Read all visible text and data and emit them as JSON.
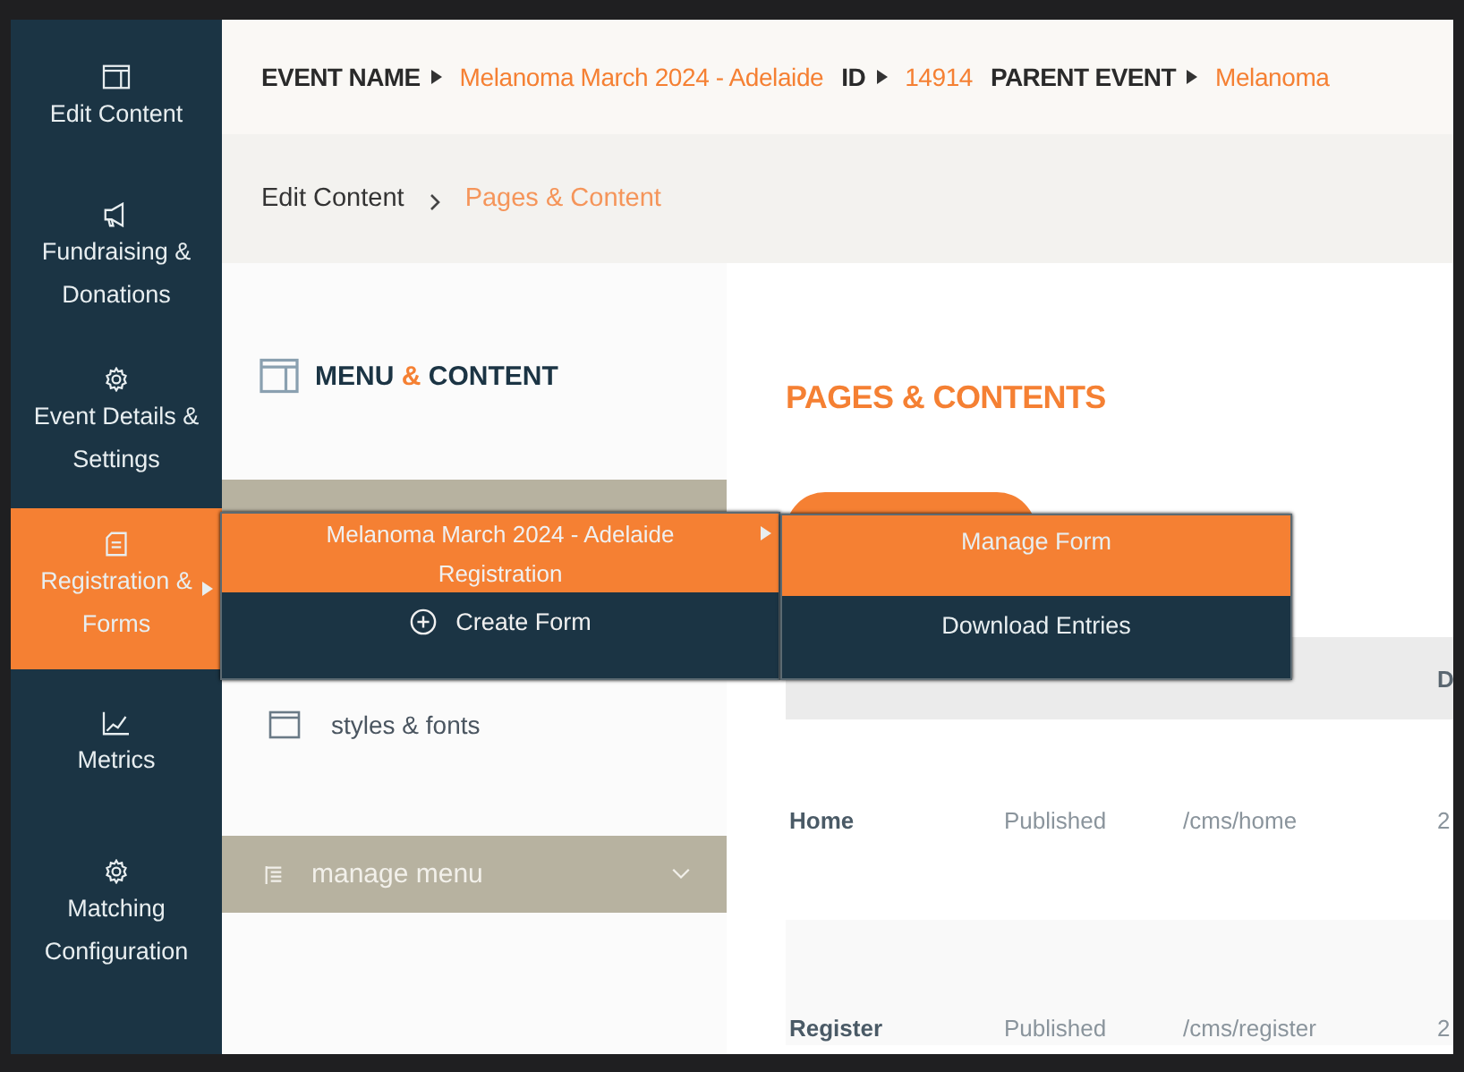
{
  "sidebar": {
    "items": [
      {
        "label": "Edit Content",
        "selected": false,
        "submenu": false
      },
      {
        "label": "Fundraising & Donations",
        "selected": false,
        "submenu": false
      },
      {
        "label": "Event Details & Settings",
        "selected": false,
        "submenu": false
      },
      {
        "label": "Registration & Forms",
        "selected": true,
        "submenu": true
      },
      {
        "label": "Metrics",
        "selected": false,
        "submenu": false
      },
      {
        "label": "Matching Configuration",
        "selected": false,
        "submenu": false
      }
    ]
  },
  "event_bar": [
    {
      "label": "EVENT NAME",
      "value": "Melanoma March 2024 - Adelaide"
    },
    {
      "label": "ID",
      "value": "14914"
    },
    {
      "label": "PARENT EVENT",
      "value": "Melanoma"
    }
  ],
  "breadcrumb": [
    {
      "label": "Edit Content",
      "current": false
    },
    {
      "label": "Pages & Content",
      "current": true
    }
  ],
  "menu_panel": {
    "title": [
      {
        "text": "MENU",
        "accent": false
      },
      {
        "text": "&",
        "accent": true
      },
      {
        "text": "CONTENT",
        "accent": false
      }
    ],
    "items": [
      {
        "label": "styles & fonts"
      }
    ],
    "manage_menu": {
      "label": "manage menu",
      "expanded": false
    }
  },
  "pages": {
    "title": "PAGES & CONTENTS",
    "table": {
      "columns": [
        "",
        "",
        "",
        "D"
      ],
      "rows": [
        [
          "Home",
          "Published",
          "/cms/home",
          "2"
        ],
        [
          "Register",
          "Published",
          "/cms/register",
          "2"
        ]
      ]
    }
  },
  "popup_menu": {
    "items": [
      {
        "label": "Melanoma March 2024 - Adelaide Registration",
        "kind": "submenu",
        "selected": true
      },
      {
        "label": "Create Form",
        "kind": "action",
        "selected": false
      }
    ]
  },
  "submenu": {
    "items": [
      {
        "label": "Manage Form",
        "selected": true
      },
      {
        "label": "Download Entries",
        "selected": false
      }
    ]
  }
}
